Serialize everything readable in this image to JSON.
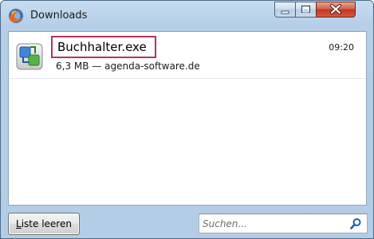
{
  "window": {
    "title": "Downloads",
    "icon": "firefox-icon",
    "controls": [
      "minimize-icon",
      "maximize-icon",
      "close-icon"
    ]
  },
  "downloads": [
    {
      "name": "Buchhalter.exe",
      "time": "09:20",
      "info": "6,3 MB — agenda-software.de",
      "icon": "exe-installer-icon"
    }
  ],
  "footer": {
    "clear_button_label_accel": "L",
    "clear_button_label_rest": "iste leeren",
    "search_placeholder": "Suchen..."
  },
  "colors": {
    "highlight_border": "#b5345a",
    "close_button": "#c4361e"
  }
}
